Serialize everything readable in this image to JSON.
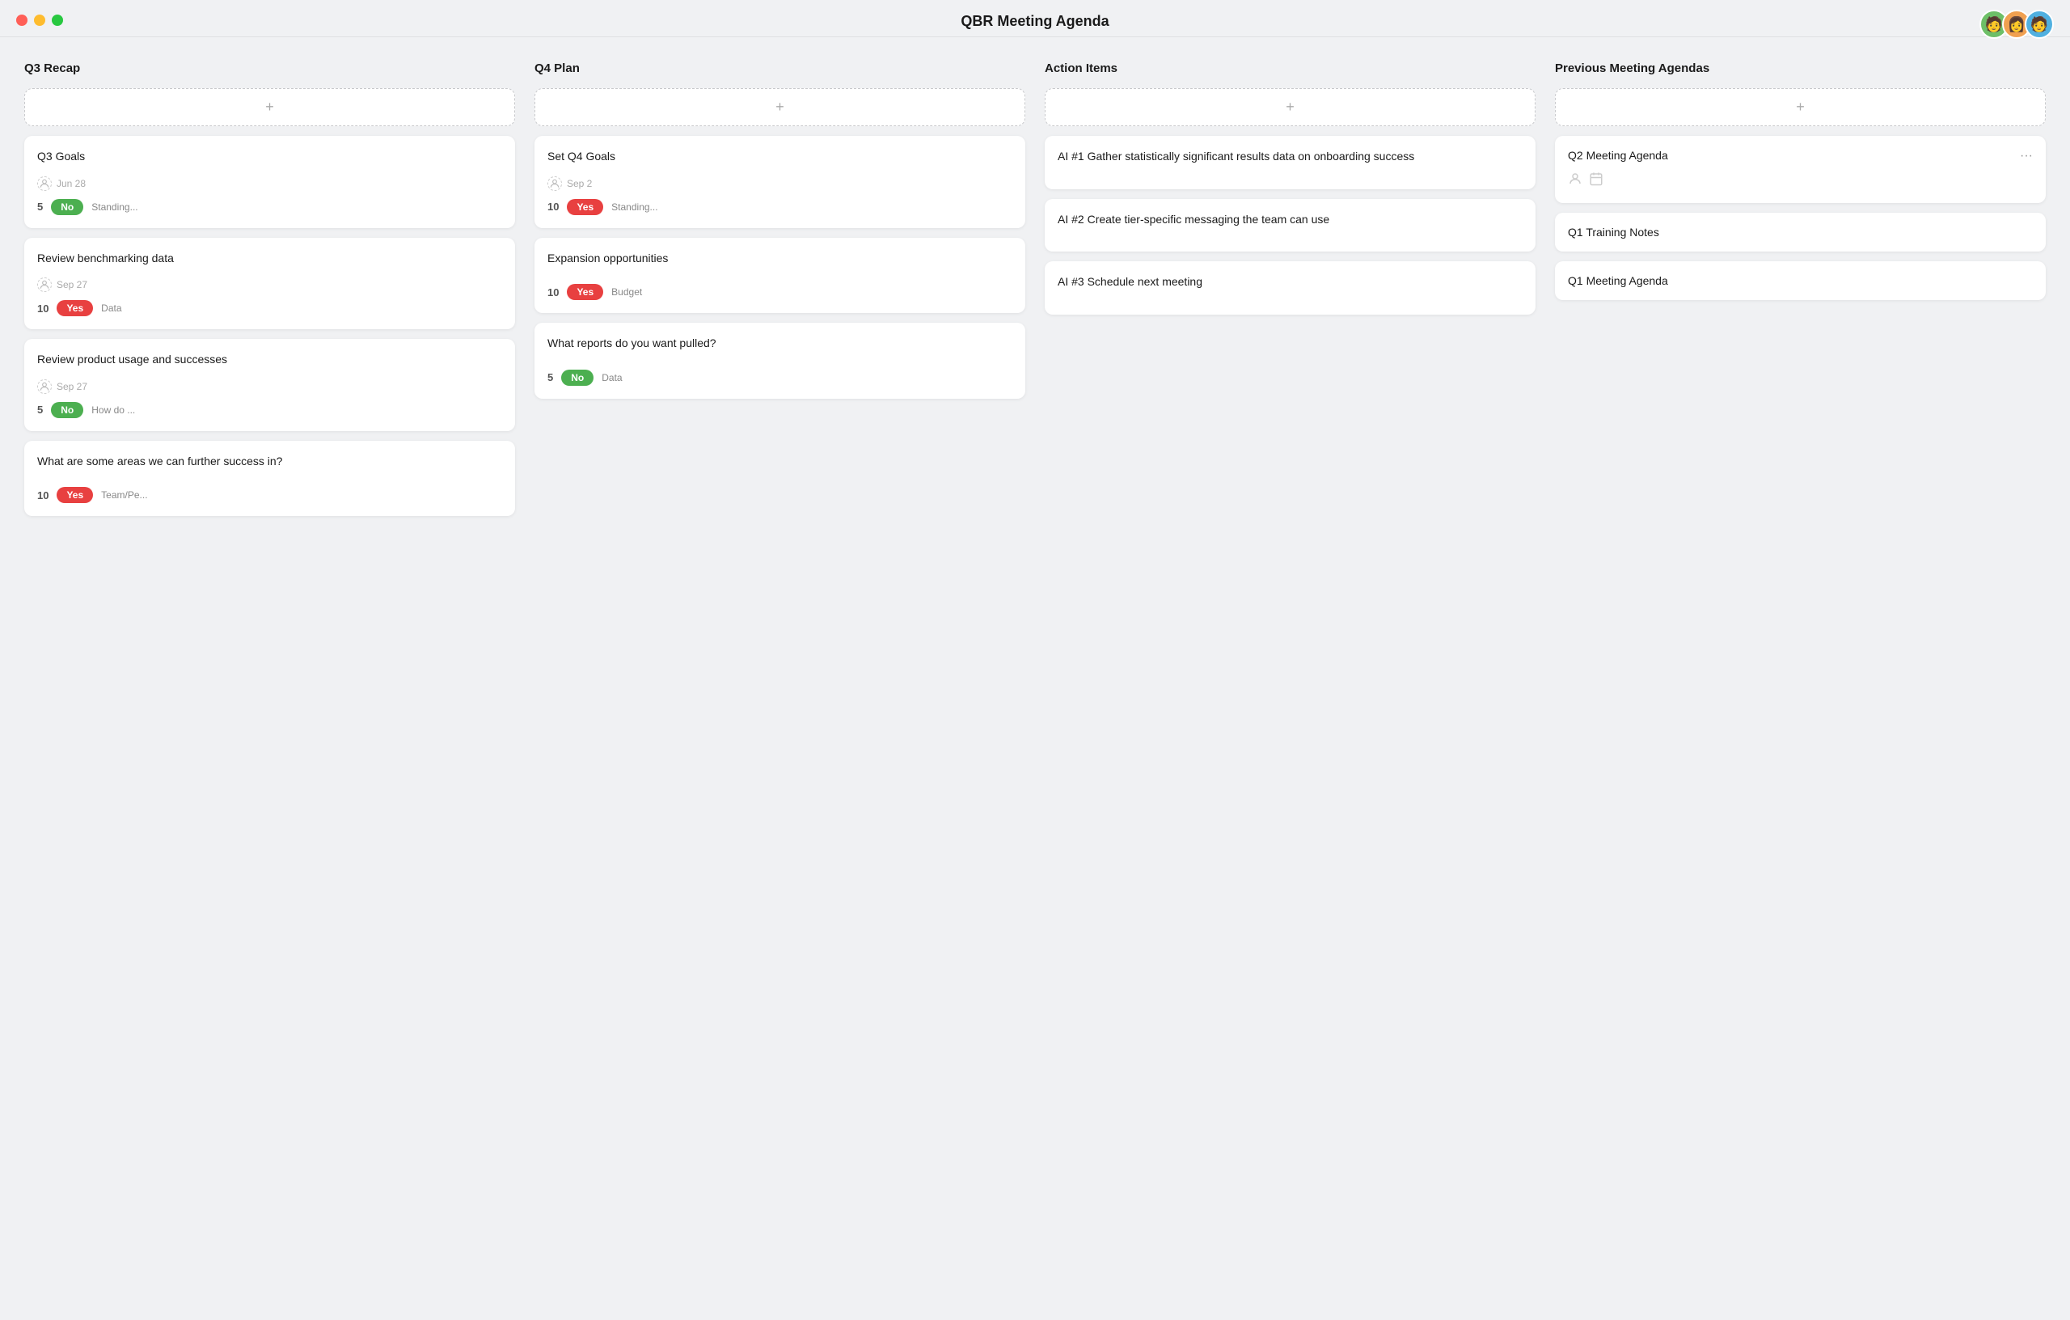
{
  "titleBar": {
    "title": "QBR Meeting Agenda"
  },
  "avatars": [
    {
      "emoji": "🧑",
      "color": "#6dbf67"
    },
    {
      "emoji": "👩",
      "color": "#f0a050"
    },
    {
      "emoji": "🧑",
      "color": "#50b0e0"
    }
  ],
  "columns": [
    {
      "id": "q3-recap",
      "header": "Q3 Recap",
      "addLabel": "+",
      "cards": [
        {
          "id": "q3-goals",
          "title": "Q3 Goals",
          "date": "Jun 28",
          "number": 5,
          "badge": "No",
          "badgeType": "no",
          "extra": "Standing..."
        },
        {
          "id": "review-benchmarking",
          "title": "Review benchmarking data",
          "date": "Sep 27",
          "number": 10,
          "badge": "Yes",
          "badgeType": "yes",
          "extra": "Data"
        },
        {
          "id": "review-product-usage",
          "title": "Review product usage and successes",
          "date": "Sep 27",
          "number": 5,
          "badge": "No",
          "badgeType": "no",
          "extra": "How do ..."
        },
        {
          "id": "further-success",
          "title": "What are some areas we can further success in?",
          "date": null,
          "number": 10,
          "badge": "Yes",
          "badgeType": "yes",
          "extra": "Team/Pe..."
        }
      ]
    },
    {
      "id": "q4-plan",
      "header": "Q4 Plan",
      "addLabel": "+",
      "cards": [
        {
          "id": "set-q4-goals",
          "title": "Set Q4 Goals",
          "date": "Sep 2",
          "number": 10,
          "badge": "Yes",
          "badgeType": "yes",
          "extra": "Standing..."
        },
        {
          "id": "expansion-opps",
          "title": "Expansion opportunities",
          "date": null,
          "number": 10,
          "badge": "Yes",
          "badgeType": "yes",
          "extra": "Budget"
        },
        {
          "id": "what-reports",
          "title": "What reports do you want pulled?",
          "date": null,
          "number": 5,
          "badge": "No",
          "badgeType": "no",
          "extra": "Data"
        }
      ]
    },
    {
      "id": "action-items",
      "header": "Action Items",
      "addLabel": "+",
      "cards": [
        {
          "id": "ai1",
          "title": "AI #1 Gather statistically significant results data on onboarding success",
          "date": null,
          "number": null,
          "badge": null,
          "badgeType": null,
          "extra": null
        },
        {
          "id": "ai2",
          "title": "AI #2 Create tier-specific messaging the team can use",
          "date": null,
          "number": null,
          "badge": null,
          "badgeType": null,
          "extra": null
        },
        {
          "id": "ai3",
          "title": "AI #3 Schedule next meeting",
          "date": null,
          "number": null,
          "badge": null,
          "badgeType": null,
          "extra": null
        }
      ]
    },
    {
      "id": "prev-agendas",
      "header": "Previous Meeting Agendas",
      "addLabel": "+",
      "cards": [
        {
          "id": "q2-agenda",
          "title": "Q2 Meeting Agenda",
          "hasIcons": true,
          "hasDots": true
        },
        {
          "id": "q1-training",
          "title": "Q1 Training Notes",
          "hasIcons": false,
          "hasDots": false
        },
        {
          "id": "q1-agenda",
          "title": "Q1 Meeting Agenda",
          "hasIcons": false,
          "hasDots": false
        }
      ]
    }
  ]
}
